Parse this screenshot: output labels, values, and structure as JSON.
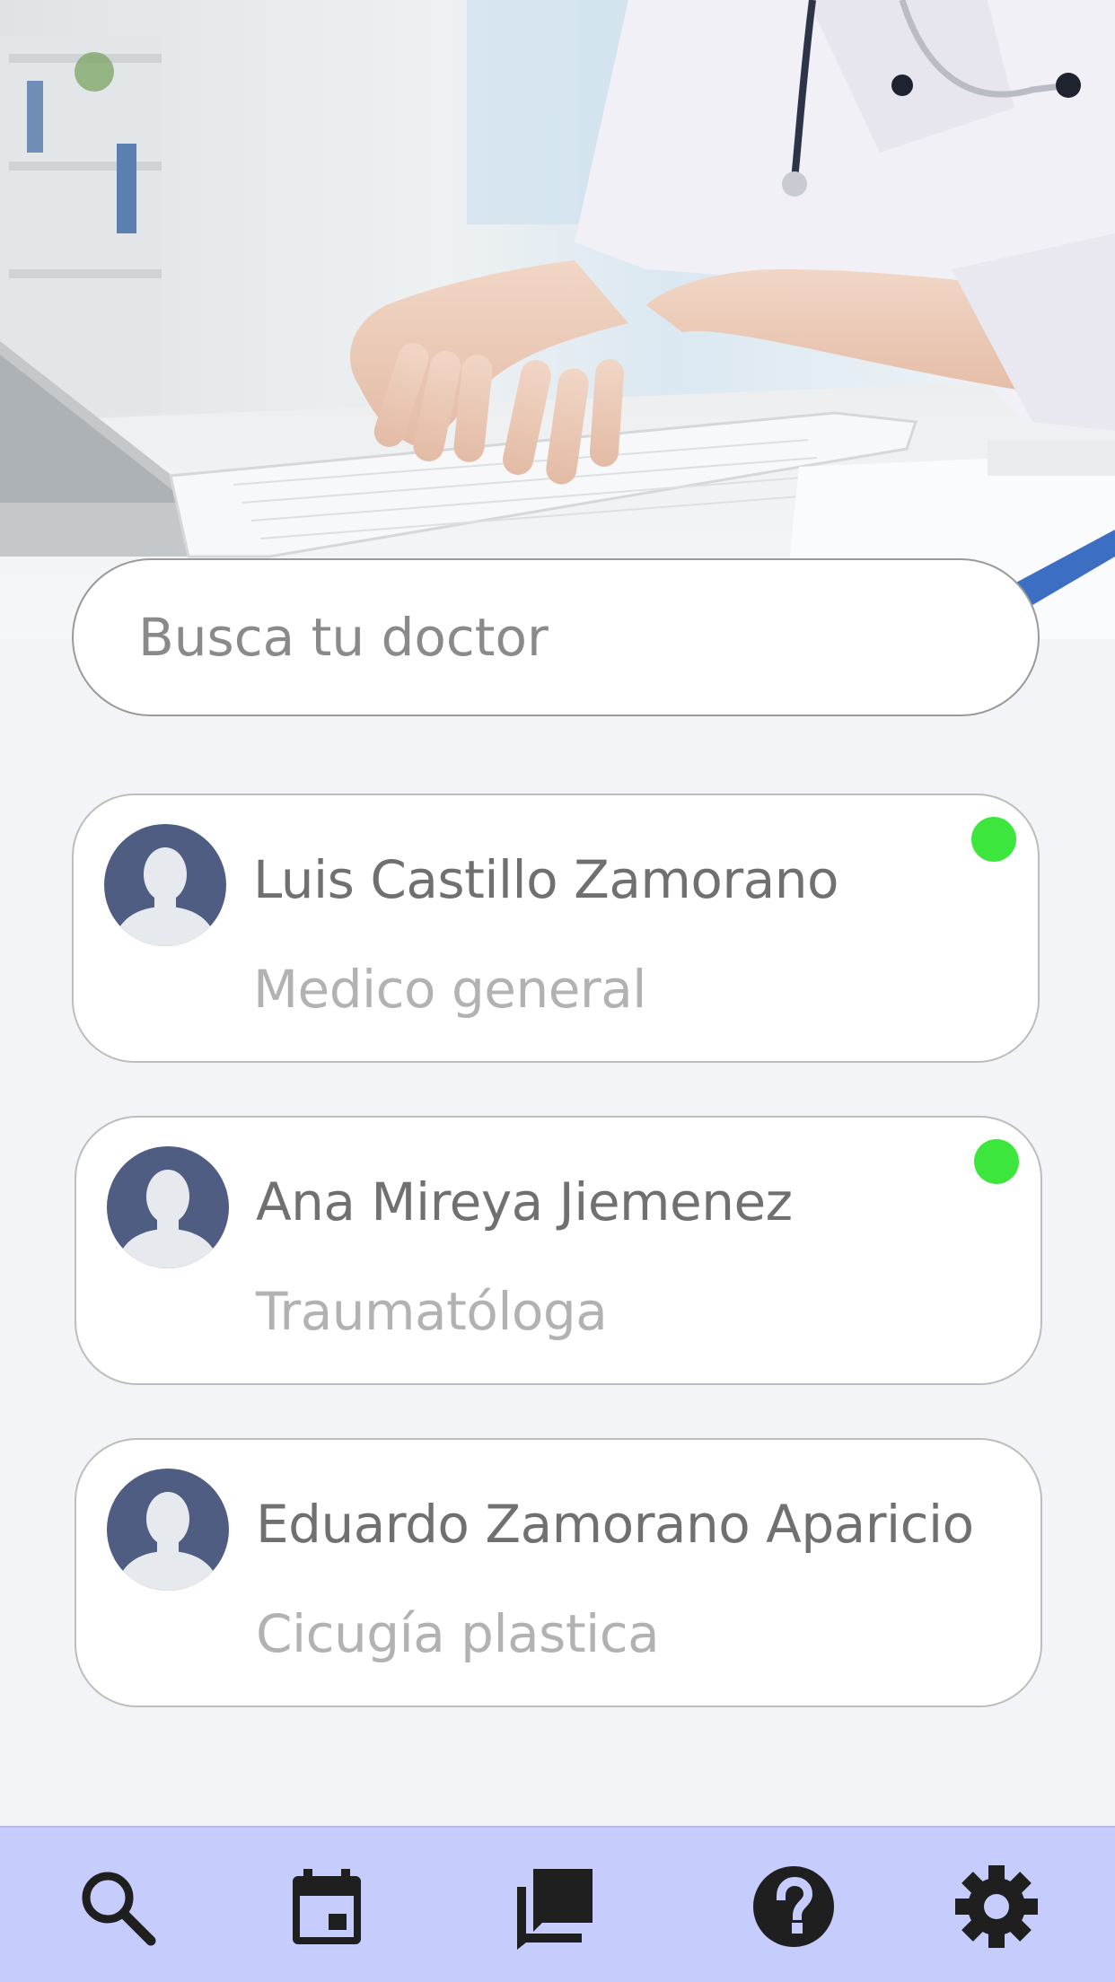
{
  "search": {
    "placeholder": "Busca tu doctor"
  },
  "doctors": [
    {
      "name": "Luis Castillo Zamorano",
      "specialty": "Medico general",
      "online": true
    },
    {
      "name": "Ana Mireya Jiemenez",
      "specialty": "Traumatóloga",
      "online": true
    },
    {
      "name": "Eduardo Zamorano Aparicio",
      "specialty": "Cicugía plastica",
      "online": false
    }
  ],
  "colors": {
    "background": "#f3f4f8",
    "nav_background": "#c6ccfb",
    "online": "#3de63d",
    "avatar": "#4f5d82",
    "icon": "#1f1f1f"
  },
  "nav": {
    "items": [
      "search-icon",
      "calendar-icon",
      "chat-icon",
      "help-icon",
      "settings-icon"
    ]
  }
}
